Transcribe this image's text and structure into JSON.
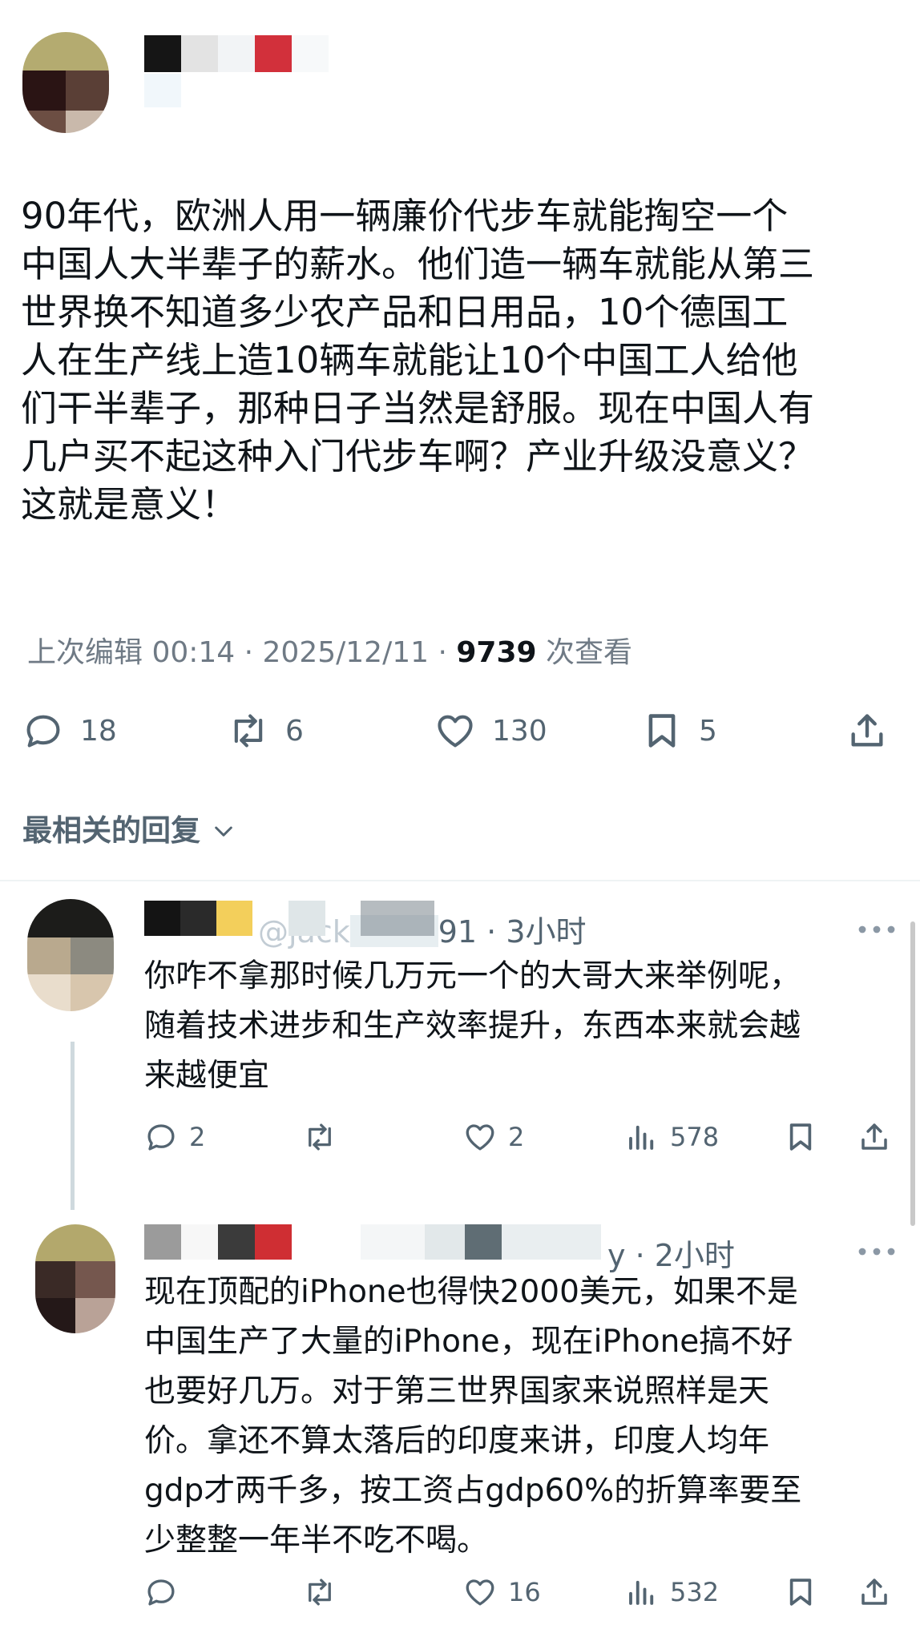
{
  "post": {
    "text": "90年代，欧洲人用一辆廉价代步车就能掏空一个\n中国人大半辈子的薪水。他们造一辆车就能从第三\n世界换不知道多少农产品和日用品，10个德国工\n人在生产线上造10辆车就能让10个中国工人给他\n们干半辈子，那种日子当然是舒服。现在中国人有\n几户买不起这种入门代步车啊？产业升级没意义？\n这就是意义！",
    "meta_prefix": "上次编辑 00:14 · 2025/12/11 · ",
    "views_count": "9739",
    "views_label": " 次查看",
    "replies": "18",
    "reposts": "6",
    "likes": "130",
    "bookmarks": "5"
  },
  "sort_label": "最相关的回复",
  "reply1": {
    "handle": "@jack",
    "handle_tail": "91 · 3小时",
    "text": "你咋不拿那时候几万元一个的大哥大来举例呢，\n随着技术进步和生产效率提升，东西本来就会越\n来越便宜",
    "replies": "2",
    "likes": "2",
    "views": "578"
  },
  "reply2": {
    "handle_tail": "y · 2小时",
    "text": "现在顶配的iPhone也得快2000美元，如果不是\n中国生产了大量的iPhone，现在iPhone搞不好\n也要好几万。对于第三世界国家来说照样是天\n价。拿还不算太落后的印度来讲，印度人均年\ngdp才两千多，按工资占gdp60%的折算率要至\n少整整一年半不吃不喝。",
    "likes": "16",
    "views": "532"
  },
  "colors": {
    "text": "#0f1419",
    "muted": "#536471",
    "line": "#cfd9de"
  },
  "icons": [
    "reply-icon",
    "repost-icon",
    "like-icon",
    "bookmark-icon",
    "share-icon",
    "views-icon",
    "chevron-down-icon",
    "more-icon"
  ]
}
